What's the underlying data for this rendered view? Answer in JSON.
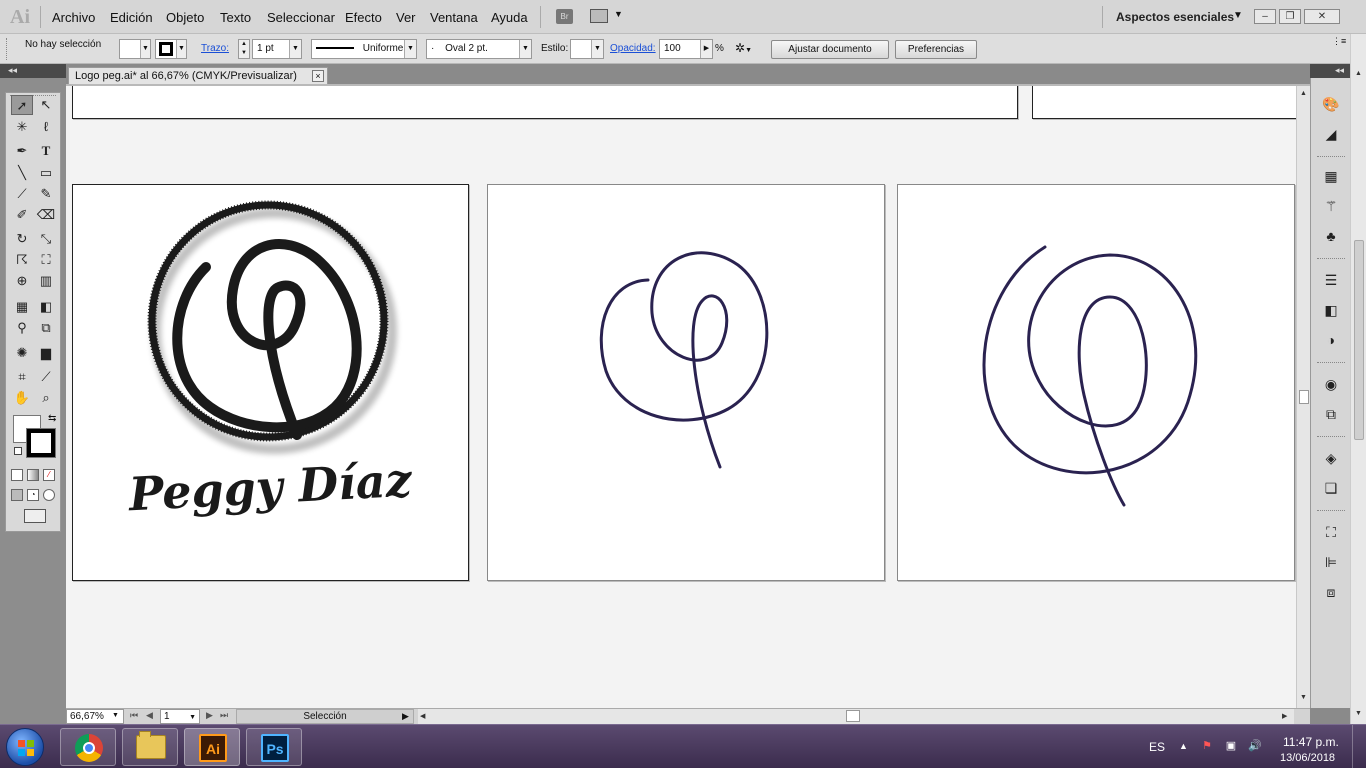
{
  "app": {
    "logo_text": "Ai"
  },
  "menu": {
    "items": [
      "Archivo",
      "Edición",
      "Objeto",
      "Texto",
      "Seleccionar",
      "Efecto",
      "Ver",
      "Ventana",
      "Ayuda"
    ],
    "bridge_label": "Br",
    "workspace": "Aspectos esenciales"
  },
  "window_controls": {
    "minimize": "–",
    "restore": "❐",
    "close": "✕"
  },
  "control_bar": {
    "selection_status": "No hay selección",
    "stroke_label": "Trazo:",
    "stroke_weight": "1 pt",
    "stroke_profile": "Uniforme",
    "brush": "Oval 2 pt.",
    "style_label": "Estilo:",
    "opacity_label": "Opacidad:",
    "opacity_value": "100",
    "opacity_unit": "%",
    "fit_document_button": "Ajustar documento",
    "preferences_button": "Preferencias"
  },
  "document": {
    "tab_title": "Logo peg.ai* al 66,67% (CMYK/Previsualizar)",
    "close_glyph": "×"
  },
  "artboards": {
    "logo_text": "Peggy Díaz",
    "stroke_color": "#2a2250",
    "logo_color": "#1a1a1a"
  },
  "status_bar": {
    "zoom": "66,67%",
    "page": "1",
    "status_text": "Selección"
  },
  "taskbar": {
    "language": "ES",
    "time": "11:47 p.m.",
    "date": "13/06/2018",
    "apps": [
      {
        "name": "chrome",
        "label": ""
      },
      {
        "name": "explorer",
        "label": ""
      },
      {
        "name": "illustrator",
        "label": "Ai"
      },
      {
        "name": "photoshop",
        "label": "Ps"
      }
    ]
  },
  "colors": {
    "accent_link": "#1a4fd6",
    "canvas_bg": "#f3f3f3",
    "taskbar": "#4a3a5e"
  },
  "icons": {
    "tools": [
      "selection-tool-icon",
      "direct-selection-tool-icon",
      "magic-wand-icon",
      "lasso-icon",
      "pen-tool-icon",
      "type-tool-icon",
      "line-tool-icon",
      "rectangle-tool-icon",
      "paintbrush-icon",
      "pencil-icon",
      "blob-brush-icon",
      "eraser-icon",
      "rotate-icon",
      "scale-icon",
      "warp-icon",
      "free-transform-icon",
      "shape-builder-icon",
      "perspective-grid-icon",
      "mesh-icon",
      "gradient-icon",
      "eyedropper-icon",
      "blend-icon",
      "symbol-sprayer-icon",
      "column-graph-icon",
      "artboard-tool-icon",
      "slice-icon",
      "hand-tool-icon",
      "zoom-tool-icon"
    ]
  }
}
